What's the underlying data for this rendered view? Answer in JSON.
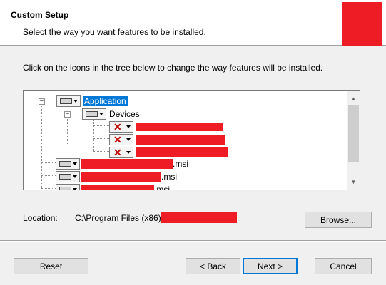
{
  "header": {
    "title": "Custom Setup",
    "subtitle": "Select the way you want features to be installed."
  },
  "instruction": "Click on the icons in the tree below to change the way features will be installed.",
  "tree": {
    "items": [
      {
        "label": "Application",
        "selected": true,
        "state": "install"
      },
      {
        "label": "Devices",
        "selected": false,
        "state": "install"
      },
      {
        "label": "",
        "state": "not-installed"
      },
      {
        "label": "",
        "state": "not-installed"
      },
      {
        "label": "",
        "state": "not-installed"
      },
      {
        "label_suffix": ".msi",
        "state": "install"
      },
      {
        "label_suffix": ".msi",
        "state": "install"
      },
      {
        "label_suffix": ".msi",
        "state": "install"
      }
    ]
  },
  "location": {
    "label": "Location:",
    "path": "C:\\Program Files (x86)\\"
  },
  "buttons": {
    "browse": "Browse...",
    "reset": "Reset",
    "back": "< Back",
    "next": "Next >",
    "cancel": "Cancel"
  },
  "colors": {
    "redaction": "#ee1c25",
    "selection": "#0078d7",
    "not_installed_x": "#c00000"
  },
  "icons": {
    "install": "drive-icon",
    "not_installed": "red-x-icon",
    "expand": "minus-expander-icon"
  }
}
